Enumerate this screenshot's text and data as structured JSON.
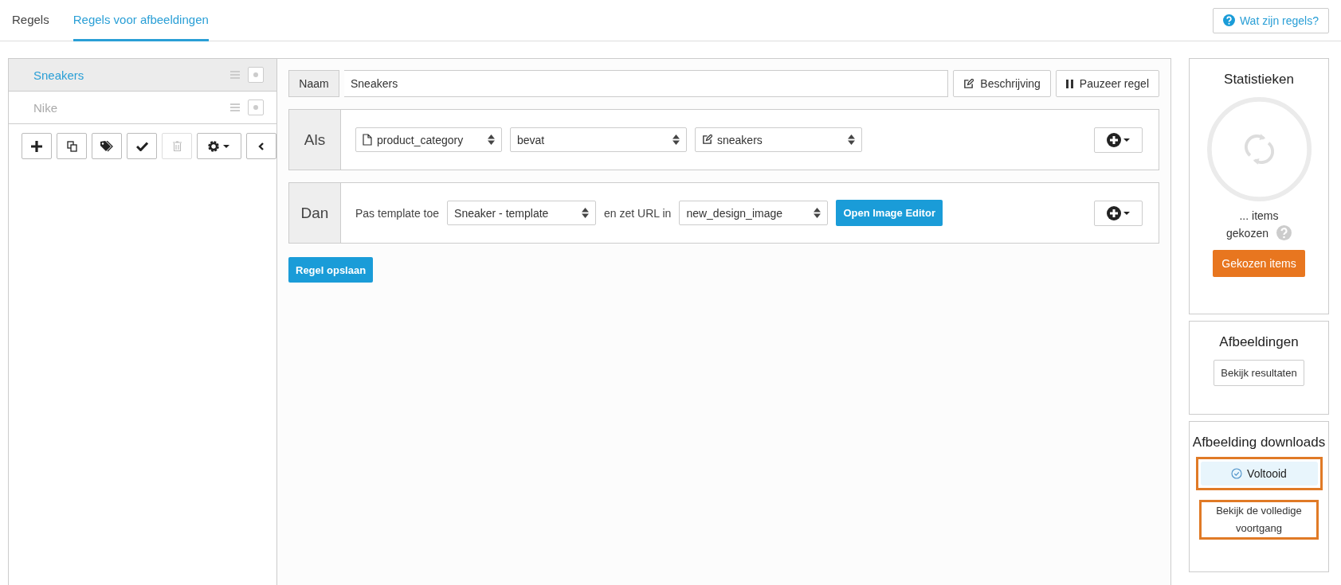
{
  "tabs": [
    {
      "label": "Regels",
      "selected": false
    },
    {
      "label": "Regels voor afbeeldingen",
      "selected": true
    }
  ],
  "help_button": {
    "label": "Wat zijn regels?"
  },
  "rules": [
    {
      "name": "Sneakers",
      "selected": true
    },
    {
      "name": "Nike",
      "selected": false
    }
  ],
  "rule_toolbar": [
    {
      "kind": "add",
      "disabled": false
    },
    {
      "kind": "copy",
      "disabled": false
    },
    {
      "kind": "tags",
      "disabled": false
    },
    {
      "kind": "check",
      "disabled": false
    },
    {
      "kind": "trash",
      "disabled": true
    },
    {
      "kind": "gear",
      "disabled": false
    },
    {
      "kind": "collapse",
      "disabled": false
    }
  ],
  "editor": {
    "name_label": "Naam",
    "name_value": "Sneakers",
    "buttons": [
      {
        "kind": "edit",
        "label": "Beschrijving"
      },
      {
        "kind": "pause",
        "label": "Pauzeer regel"
      }
    ],
    "conditions": {
      "label": "Als",
      "parts": [
        {
          "kind": "file",
          "value": "product_category"
        },
        {
          "kind": "plain",
          "value": "bevat"
        },
        {
          "kind": "edit",
          "value": "sneakers"
        }
      ]
    },
    "actions": {
      "label": "Dan",
      "parts": [
        {
          "kind": "text",
          "value": "Pas template toe"
        },
        {
          "kind": "select",
          "value": "Sneaker - template"
        },
        {
          "kind": "text",
          "value": "en zet URL in"
        },
        {
          "kind": "select",
          "value": "new_design_image"
        },
        {
          "kind": "button",
          "value": "Open Image Editor"
        }
      ]
    },
    "save_button": "Regel opslaan"
  },
  "statistics": {
    "title": "Statistieken",
    "items": "... items",
    "chosen": "gekozen",
    "button": "Gekozen items"
  },
  "images": {
    "title": "Afbeeldingen",
    "button": "Bekijk resultaten"
  },
  "downloads": {
    "title": "Afbeelding downloads",
    "status": "Voltooid",
    "status_highlighted": true,
    "link": "Bekijk de volledige voortgang",
    "link_highlighted": true
  }
}
